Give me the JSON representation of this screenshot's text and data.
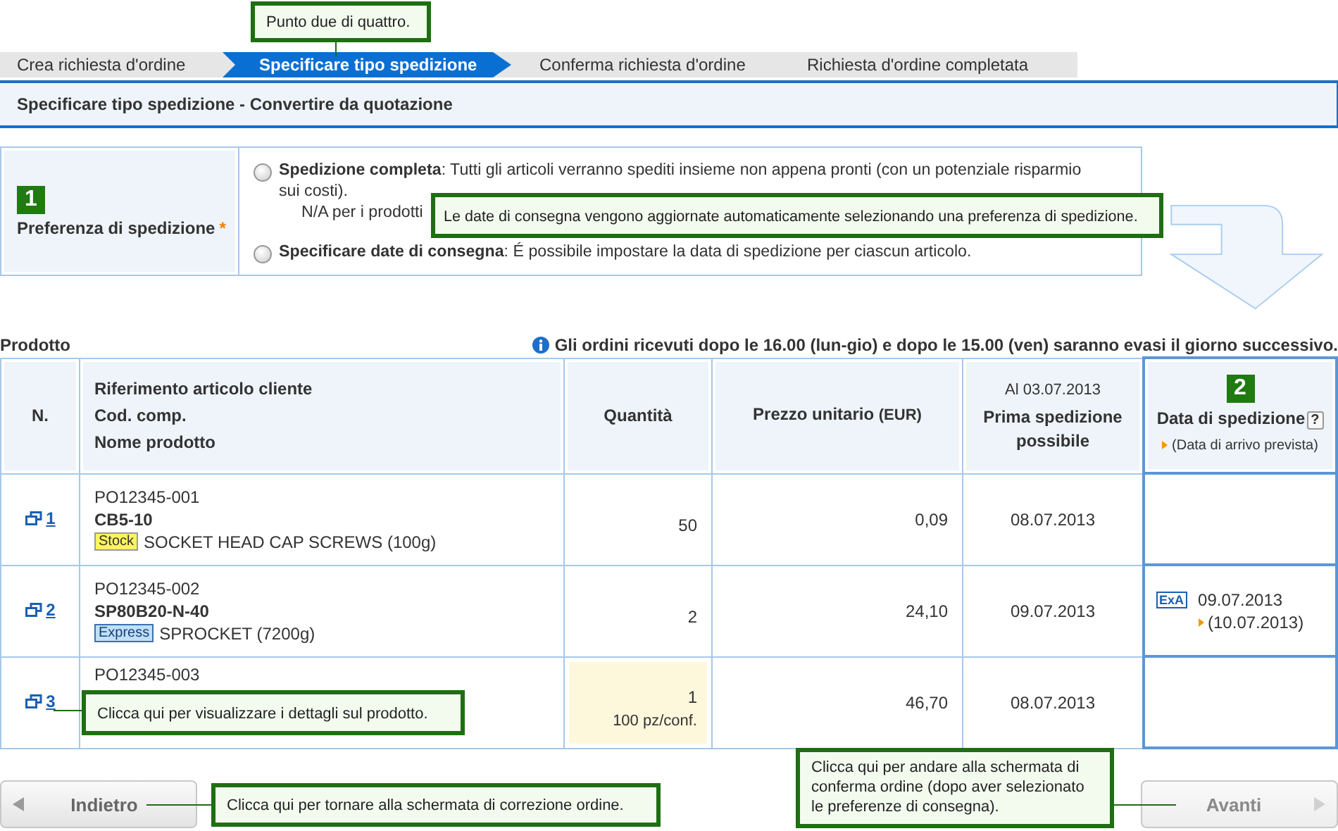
{
  "steps": [
    {
      "label": "Crea richiesta d'ordine",
      "selected": false
    },
    {
      "label": "Specificare tipo spedizione",
      "selected": true
    },
    {
      "label": "Conferma richiesta d'ordine",
      "selected": false
    },
    {
      "label": "Richiesta d'ordine completata",
      "selected": false
    }
  ],
  "step_callout": "Punto due di quattro.",
  "page_title": "Specificare tipo spedizione - Convertire da quotazione",
  "shipping_preference": {
    "marker": "1",
    "label": "Preferenza di spedizione",
    "required_mark": "*",
    "options": [
      {
        "text": "**Spedizione completa**: Tutti gli articoli verranno spediti insieme non appena pronti (con un potenziale risparmio sui costi).",
        "note": "N/A per i prodotti",
        "selected": false
      },
      {
        "text": "**Specificare date di consegna**: É possibile impostare la data di spedizione per ciascun articolo.",
        "selected": false
      }
    ],
    "callout": "Le date di consegna vengono aggiornate automaticamente selezionando una preferenza di spedizione."
  },
  "product_section": {
    "title": "Prodotto",
    "notice": "Gli ordini ricevuti dopo le 16.00 (lun-gio) e dopo le 15.00 (ven) saranno evasi il giorno successivo."
  },
  "table": {
    "columns": [
      {
        "lines": [
          "N."
        ]
      },
      {
        "lines": [
          "Riferimento articolo cliente",
          "Cod. comp.",
          "Nome prodotto"
        ]
      },
      {
        "lines": [
          "Quantità"
        ]
      },
      {
        "lines": [
          "Prezzo unitario"
        ],
        "unit": "(EUR)"
      },
      {
        "lines": [
          "Prima spedizione possibile"
        ],
        "above": "Al 03.07.2013"
      },
      {
        "lines": [
          "Data di spedizione"
        ],
        "marker": "2",
        "help": "?",
        "sub": "(Data di arrivo prevista)"
      }
    ],
    "rows": [
      {
        "no": "1",
        "po": "PO12345-001",
        "code": "CB5-10",
        "tag": {
          "kind": "stock",
          "label": "Stock"
        },
        "name": "SOCKET HEAD CAP SCREWS (100g)",
        "quantity": "50",
        "quantity_highlighted": false,
        "price": "0,09",
        "first_ship": "08.07.2013"
      },
      {
        "no": "2",
        "po": "PO12345-002",
        "code": "SP80B20-N-40",
        "tag": {
          "kind": "express",
          "label": "Express"
        },
        "name": "SPROCKET (7200g)",
        "quantity": "2",
        "quantity_highlighted": false,
        "price": "24,10",
        "first_ship": "09.07.2013",
        "ship_date": {
          "badge": "ExA",
          "date": "09.07.2013",
          "arrival": "(10.07.2013)"
        }
      },
      {
        "no": "3",
        "po": "PO12345-003",
        "quantity": "1",
        "pack": "100 pz/conf.",
        "quantity_highlighted": true,
        "price": "46,70",
        "first_ship": "08.07.2013"
      }
    ],
    "row_callout": "Clicca qui per visualizzare i dettagli sul prodotto."
  },
  "back_button": {
    "label": "Indietro",
    "disabled": false,
    "callout": "Clicca qui per tornare alla schermata di correzione ordine."
  },
  "next_button": {
    "label": "Avanti",
    "disabled": true,
    "callout": "Clicca qui per andare alla schermata di conferma ordine (dopo aver selezionato le preferenze di consegna)."
  }
}
